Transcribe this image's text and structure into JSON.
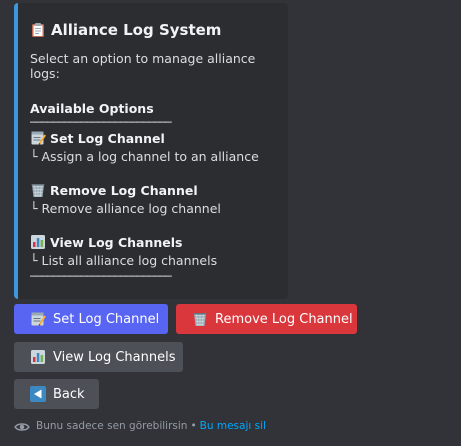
{
  "embed": {
    "accent_color": "#3b98e0",
    "title_icon": "clipboard-icon",
    "title": "Alliance Log System",
    "description": "Select an option to manage alliance logs:",
    "section_title": "Available Options",
    "divider": "─────────────────────────",
    "options": [
      {
        "icon": "memo-icon",
        "title": "Set Log Channel",
        "desc": "└ Assign a log channel to an alliance"
      },
      {
        "icon": "wastebasket-icon",
        "title": "Remove Log Channel",
        "desc": "└ Remove alliance log channel"
      },
      {
        "icon": "bar-chart-icon",
        "title": "View Log Channels",
        "desc": "└ List all alliance log channels"
      }
    ]
  },
  "buttons": {
    "set_label": "Set Log Channel",
    "set_color": "#5865f2",
    "remove_label": "Remove Log Channel",
    "remove_color": "#da373c",
    "view_label": "View Log Channels",
    "view_color": "#4e5058",
    "back_label": "Back",
    "back_color": "#4e5058"
  },
  "footer": {
    "icon": "eye-icon",
    "text": "Bunu sadece sen görebilirsin",
    "separator": "•",
    "link": "Bu mesajı sil"
  }
}
